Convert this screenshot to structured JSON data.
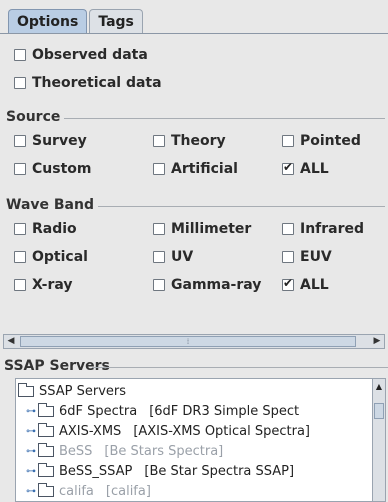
{
  "tabs": [
    "Options",
    "Tags"
  ],
  "options": {
    "observed": "Observed data",
    "theoretical": "Theoretical data"
  },
  "source": {
    "title": "Source",
    "items": [
      "Survey",
      "Theory",
      "Pointed",
      "Custom",
      "Artificial",
      "ALL"
    ]
  },
  "waveband": {
    "title": "Wave Band",
    "items": [
      "Radio",
      "Millimeter",
      "Infrared",
      "Optical",
      "UV",
      "EUV",
      "X-ray",
      "Gamma-ray",
      "ALL"
    ]
  },
  "ssap": {
    "title": "SSAP Servers",
    "root": "SSAP Servers",
    "nodes": [
      {
        "name": "6dF Spectra",
        "desc": "[6dF DR3 Simple Spect"
      },
      {
        "name": "AXIS-XMS",
        "desc": "[AXIS-XMS Optical Spectra]"
      },
      {
        "name": "BeSS",
        "desc": "[Be Stars Spectra]"
      },
      {
        "name": "BeSS_SSAP",
        "desc": "[Be Star Spectra SSAP]"
      },
      {
        "name": "califa",
        "desc": "[califa]"
      }
    ]
  }
}
